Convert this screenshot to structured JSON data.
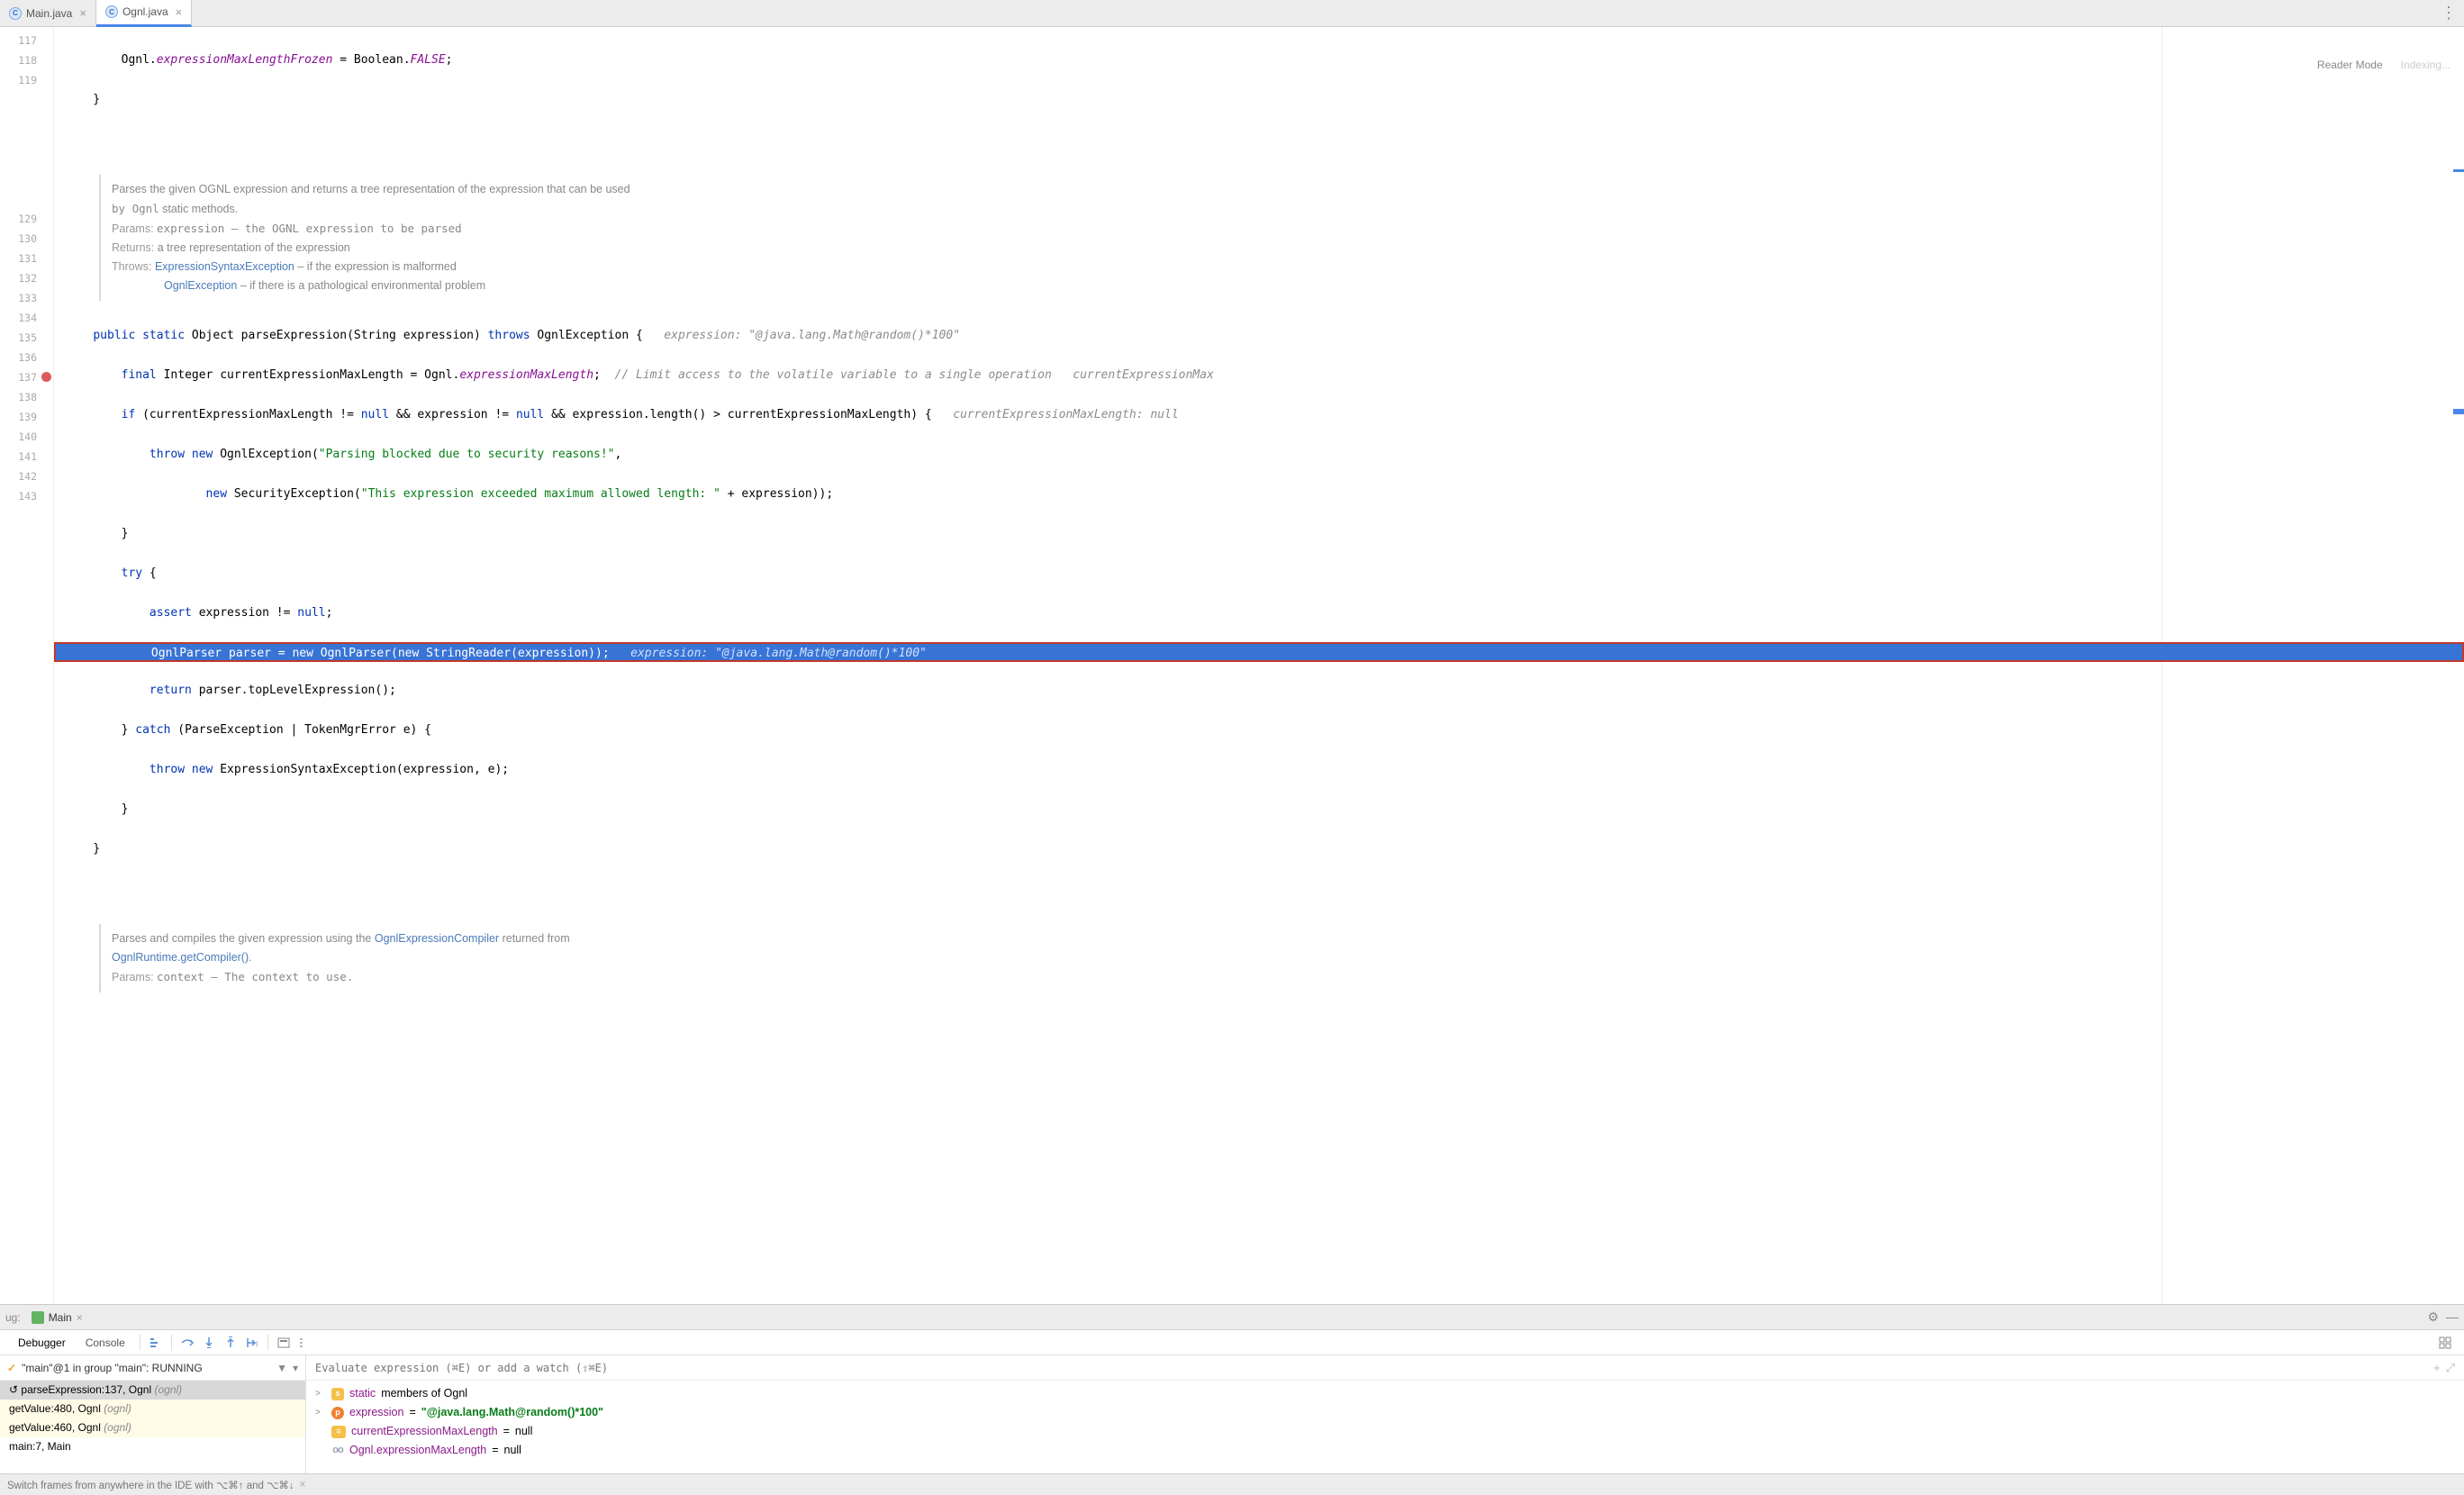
{
  "tabs": [
    {
      "icon": "C",
      "name": "Main.java",
      "active": false
    },
    {
      "icon": "C",
      "name": "Ognl.java",
      "active": true
    }
  ],
  "reader": {
    "mode": "Reader Mode",
    "indexing": "Indexing..."
  },
  "gutterStart": 117,
  "lines": {
    "l117": "        Ognl.expressionMaxLengthFrozen = Boolean.FALSE;",
    "l118": "    }",
    "l119": "",
    "doc1a": "Parses the given OGNL expression and returns a tree representation of the expression that can be used",
    "doc1b": "by Ognl static methods.",
    "doc1p": "Params:",
    "doc1pe": "expression – the OGNL expression to be parsed",
    "doc1r": "Returns:",
    "doc1re": "a tree representation of the expression",
    "doc1t": "Throws:",
    "doc1t1": "ExpressionSyntaxException",
    "doc1t1d": " – if the expression is malformed",
    "doc1t2": "OgnlException",
    "doc1t2d": " – if there is a pathological environmental problem",
    "l129": "    public static Object parseExpression(String expression) throws OgnlException {   ",
    "l129h": "expression: \"@java.lang.Math@random()*100\"",
    "l130": "        final Integer currentExpressionMaxLength = Ognl.expressionMaxLength;  ",
    "l130c": "// Limit access to the volatile variable to a single operation   currentExpressionMax",
    "l131": "        if (currentExpressionMaxLength != null && expression != null && expression.length() > currentExpressionMaxLength) {   ",
    "l131h": "currentExpressionMaxLength: null",
    "l132": "            throw new OgnlException(\"Parsing blocked due to security reasons!\",",
    "l133": "                    new SecurityException(\"This expression exceeded maximum allowed length: \" + expression));",
    "l134": "        }",
    "l135": "        try {",
    "l136": "            assert expression != null;",
    "l137": "            OgnlParser parser = new OgnlParser(new StringReader(expression));   ",
    "l137h": "expression: \"@java.lang.Math@random()*100\"",
    "l138": "            return parser.topLevelExpression();",
    "l139": "        } catch (ParseException | TokenMgrError e) {",
    "l140": "            throw new ExpressionSyntaxException(expression, e);",
    "l141": "        }",
    "l142": "    }",
    "l143": "",
    "doc2a": "Parses and compiles the given expression using the ",
    "doc2l1": "OgnlExpressionCompiler",
    "doc2ad": " returned from",
    "doc2l2": "OgnlRuntime.getCompiler()",
    "doc2p": "Params:",
    "doc2pe": "context – The context to use."
  },
  "dbg": {
    "ugLabel": "ug:",
    "tabName": "Main",
    "subDebugger": "Debugger",
    "subConsole": "Console",
    "threadLabel": "\"main\"@1 in group \"main\": RUNNING",
    "frames": [
      {
        "m": "parseExpression:137, Ognl",
        "pkg": "(ognl)",
        "sel": true,
        "lib": false
      },
      {
        "m": "getValue:480, Ognl",
        "pkg": "(ognl)",
        "sel": false,
        "lib": true
      },
      {
        "m": "getValue:460, Ognl",
        "pkg": "(ognl)",
        "sel": false,
        "lib": true
      },
      {
        "m": "main:7, Main",
        "pkg": "",
        "sel": false,
        "lib": false
      }
    ],
    "evalPlaceholder": "Evaluate expression (⌘E) or add a watch (⇧⌘E)",
    "vars": [
      {
        "arrow": ">",
        "badge": "s",
        "bclass": "b-s",
        "name": "static",
        "rest": " members of Ognl"
      },
      {
        "arrow": ">",
        "badge": "p",
        "bclass": "b-p",
        "name": "expression",
        "eq": " = ",
        "val": "\"@java.lang.Math@random()*100\"",
        "vclass": "val-s"
      },
      {
        "arrow": "",
        "badge": "≡",
        "bclass": "b-f",
        "name": "currentExpressionMaxLength",
        "eq": " = ",
        "val": "null",
        "vclass": "val-n"
      },
      {
        "arrow": "",
        "badge": "oo",
        "bclass": "b-oo",
        "name": "Ognl.expressionMaxLength",
        "eq": " = ",
        "val": "null",
        "vclass": "val-n"
      }
    ]
  },
  "tip": "Switch frames from anywhere in the IDE with ⌥⌘↑ and ⌥⌘↓"
}
